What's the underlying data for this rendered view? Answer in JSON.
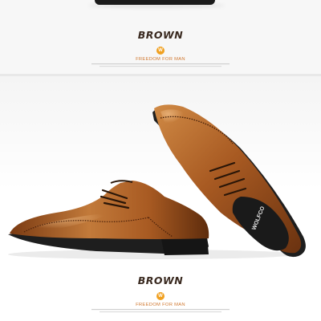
{
  "sections": [
    {
      "title": "BROWN",
      "badge": "W",
      "subtitle": "FREEDOM FOR MAN"
    },
    {
      "title": "BROWN",
      "badge": "W",
      "subtitle": "FREEDOM FOR MAN"
    }
  ],
  "insole_brand": "WOLFCO",
  "colors": {
    "leather": "#a85a22",
    "sole": "#1e1e1e",
    "accent": "#f0a020"
  }
}
